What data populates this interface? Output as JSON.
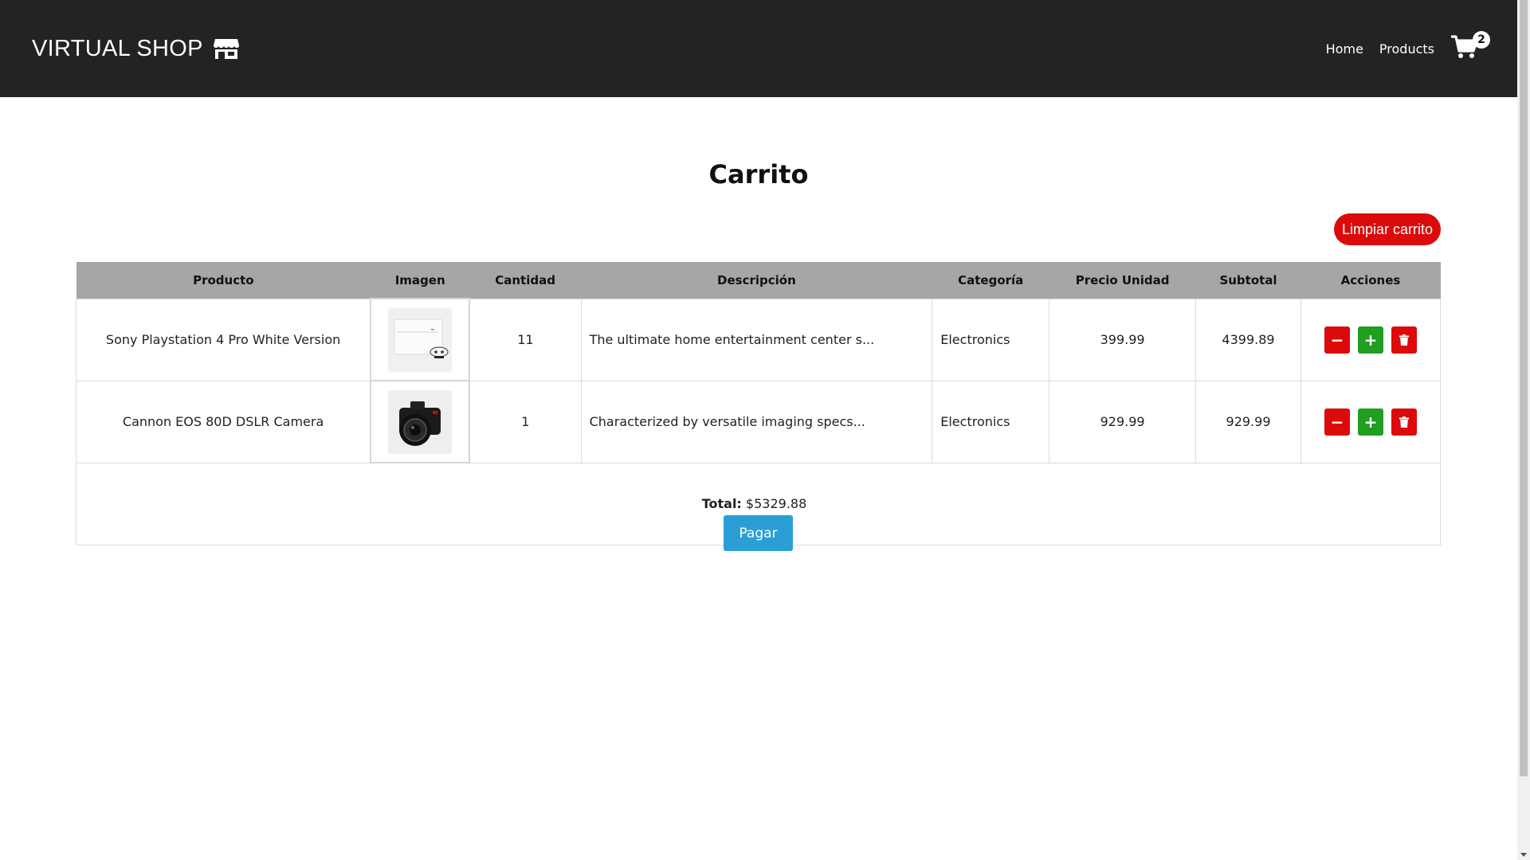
{
  "navbar": {
    "brand": "VIRTUAL SHOP",
    "links": [
      {
        "label": "Home"
      },
      {
        "label": "Products"
      }
    ],
    "cart_count": "2"
  },
  "cart": {
    "title": "Carrito",
    "clear_label": "Limpiar carrito",
    "headers": [
      "Producto",
      "Imagen",
      "Cantidad",
      "Descripción",
      "Categoría",
      "Precio Unidad",
      "Subtotal",
      "Acciones"
    ],
    "rows": [
      {
        "product": "Sony Playstation 4 Pro White Version",
        "image": "playstation-image",
        "quantity": "11",
        "description": "The ultimate home entertainment center s...",
        "category": "Electronics",
        "unit_price": "399.99",
        "subtotal": "4399.89"
      },
      {
        "product": "Cannon EOS 80D DSLR Camera",
        "image": "camera-image",
        "quantity": "1",
        "description": "Characterized by versatile imaging specs...",
        "category": "Electronics",
        "unit_price": "929.99",
        "subtotal": "929.99"
      }
    ],
    "total_label": "Total:",
    "total_value": "$5329.88",
    "pay_label": "Pagar"
  },
  "actions": {
    "decrease_symbol": "−",
    "increase_symbol": "+",
    "delete_icon": "trash-icon"
  },
  "colors": {
    "navbar_bg": "#232323",
    "danger": "#dc0a0a",
    "success": "#1f9e1f",
    "primary": "#2a9fd6",
    "table_header_bg": "#a6a6a6"
  }
}
